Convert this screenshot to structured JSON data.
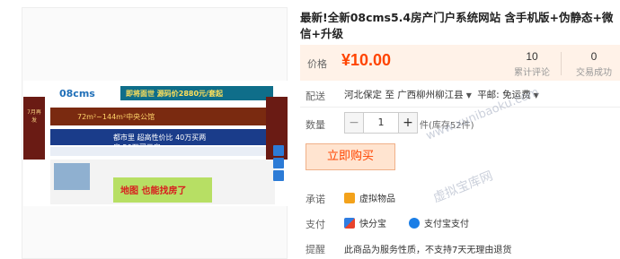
{
  "product": {
    "title": "最新!全新08cms5.4房产门户系统网站 含手机版+伪静态+微信+升级"
  },
  "gallery": {
    "logo_text": "08cms",
    "promo1": "即将面世 源码价2880元/套起",
    "promo2": "72m²~144m²中央公馆",
    "promo3": "都市里 超高性价比 40万买两房 50万买三房",
    "left_ad": "7月再发",
    "banner": "地图 也能找房了"
  },
  "price_box": {
    "label": "价格",
    "price": "¥10.00",
    "stats": [
      {
        "num": "10",
        "caption": "累计评论"
      },
      {
        "num": "0",
        "caption": "交易成功"
      }
    ]
  },
  "shipping": {
    "label": "配送",
    "from": "河北保定 至",
    "to": "广西柳州柳江县",
    "method": "平邮: 免运费"
  },
  "quantity": {
    "label": "数量",
    "minus": "−",
    "value": "1",
    "plus": "+",
    "stock": "件(库存52件)"
  },
  "buy_button": "立即购买",
  "commitment": {
    "label": "承诺",
    "item": "虚拟物品"
  },
  "payment": {
    "label": "支付",
    "methods": [
      "快分宝",
      "支付宝支付"
    ]
  },
  "notice": {
    "label": "提醒",
    "text": "此商品为服务性质，不支持7天无理由退货"
  },
  "watermark": {
    "site": "www.xunibaoku.com",
    "name": "虚拟宝库网"
  },
  "colors": {
    "price": "#ff4400",
    "price_bg": "#fff2e8",
    "buy_bg": "#ffe4d0"
  }
}
